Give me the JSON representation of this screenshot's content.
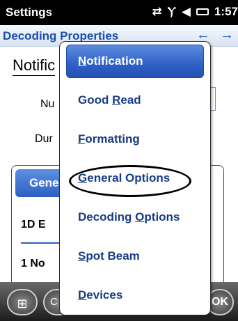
{
  "statusbar": {
    "title": "Settings",
    "icons": [
      "sync-icon",
      "signal-off-icon",
      "volume-icon",
      "battery-icon"
    ],
    "time": "1:57"
  },
  "header": {
    "title": "Decoding Properties",
    "nav_prev": "←",
    "nav_next": "→"
  },
  "background": {
    "section_title": "Notific",
    "label_1": "Nu",
    "label_2": "Dur",
    "tab_label": "Gene",
    "row_1": "1D E",
    "row_2": "1 No"
  },
  "menu": {
    "items": [
      {
        "label": "Notification",
        "pre": "",
        "ul": "N",
        "post": "otification"
      },
      {
        "label": "Good Read",
        "pre": "Good ",
        "ul": "R",
        "post": "ead"
      },
      {
        "label": "Formatting",
        "pre": "",
        "ul": "F",
        "post": "ormatting"
      },
      {
        "label": "General Options",
        "pre": "",
        "ul": "G",
        "post": "eneral Options"
      },
      {
        "label": "Decoding Options",
        "pre": "Decoding ",
        "ul": "O",
        "post": "ptions"
      },
      {
        "label": "Spot Beam",
        "pre": "",
        "ul": "S",
        "post": "pot Beam"
      },
      {
        "label": "Devices",
        "pre": "",
        "ul": "D",
        "post": "evices"
      }
    ]
  },
  "softbar": {
    "start_symbol": "⊞",
    "left_label": "C",
    "ok_label": "OK"
  },
  "colors": {
    "accent": "#2f60c6",
    "menu_text": "#1a3c83",
    "header_title": "#1a4fae"
  }
}
